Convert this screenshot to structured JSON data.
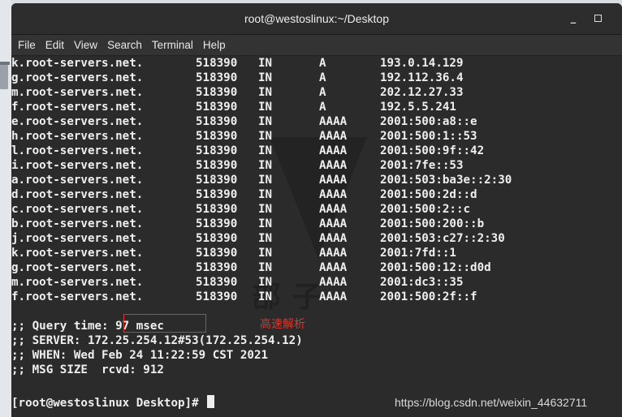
{
  "window": {
    "title": "root@westoslinux:~/Desktop"
  },
  "menu": [
    "File",
    "Edit",
    "View",
    "Search",
    "Terminal",
    "Help"
  ],
  "records": [
    {
      "name": "k.root-servers.net.",
      "ttl": "518390",
      "class": "IN",
      "type": "A",
      "data": "193.0.14.129"
    },
    {
      "name": "g.root-servers.net.",
      "ttl": "518390",
      "class": "IN",
      "type": "A",
      "data": "192.112.36.4"
    },
    {
      "name": "m.root-servers.net.",
      "ttl": "518390",
      "class": "IN",
      "type": "A",
      "data": "202.12.27.33"
    },
    {
      "name": "f.root-servers.net.",
      "ttl": "518390",
      "class": "IN",
      "type": "A",
      "data": "192.5.5.241"
    },
    {
      "name": "e.root-servers.net.",
      "ttl": "518390",
      "class": "IN",
      "type": "AAAA",
      "data": "2001:500:a8::e"
    },
    {
      "name": "h.root-servers.net.",
      "ttl": "518390",
      "class": "IN",
      "type": "AAAA",
      "data": "2001:500:1::53"
    },
    {
      "name": "l.root-servers.net.",
      "ttl": "518390",
      "class": "IN",
      "type": "AAAA",
      "data": "2001:500:9f::42"
    },
    {
      "name": "i.root-servers.net.",
      "ttl": "518390",
      "class": "IN",
      "type": "AAAA",
      "data": "2001:7fe::53"
    },
    {
      "name": "a.root-servers.net.",
      "ttl": "518390",
      "class": "IN",
      "type": "AAAA",
      "data": "2001:503:ba3e::2:30"
    },
    {
      "name": "d.root-servers.net.",
      "ttl": "518390",
      "class": "IN",
      "type": "AAAA",
      "data": "2001:500:2d::d"
    },
    {
      "name": "c.root-servers.net.",
      "ttl": "518390",
      "class": "IN",
      "type": "AAAA",
      "data": "2001:500:2::c"
    },
    {
      "name": "b.root-servers.net.",
      "ttl": "518390",
      "class": "IN",
      "type": "AAAA",
      "data": "2001:500:200::b"
    },
    {
      "name": "j.root-servers.net.",
      "ttl": "518390",
      "class": "IN",
      "type": "AAAA",
      "data": "2001:503:c27::2:30"
    },
    {
      "name": "k.root-servers.net.",
      "ttl": "518390",
      "class": "IN",
      "type": "AAAA",
      "data": "2001:7fd::1"
    },
    {
      "name": "g.root-servers.net.",
      "ttl": "518390",
      "class": "IN",
      "type": "AAAA",
      "data": "2001:500:12::d0d"
    },
    {
      "name": "m.root-servers.net.",
      "ttl": "518390",
      "class": "IN",
      "type": "AAAA",
      "data": "2001:dc3::35"
    },
    {
      "name": "f.root-servers.net.",
      "ttl": "518390",
      "class": "IN",
      "type": "AAAA",
      "data": "2001:500:2f::f"
    }
  ],
  "stats": {
    "query_time": ";; Query time: 97 msec",
    "server": ";; SERVER: 172.25.254.12#53(172.25.254.12)",
    "when": ";; WHEN: Wed Feb 24 11:22:59 CST 2021",
    "msg_size": ";; MSG SIZE  rcvd: 912"
  },
  "prompt": "[root@westoslinux Desktop]# ",
  "annotation": "高速解析",
  "source_mark": "https://blog.csdn.net/weixin_44632711",
  "watermark_text": "部子",
  "colors": {
    "terminal_bg": "#2b2b2b",
    "terminal_fg": "#efefef",
    "annotation": "#e0342b"
  },
  "icons": [
    "trash-icon",
    "minimize-icon",
    "maximize-icon"
  ]
}
